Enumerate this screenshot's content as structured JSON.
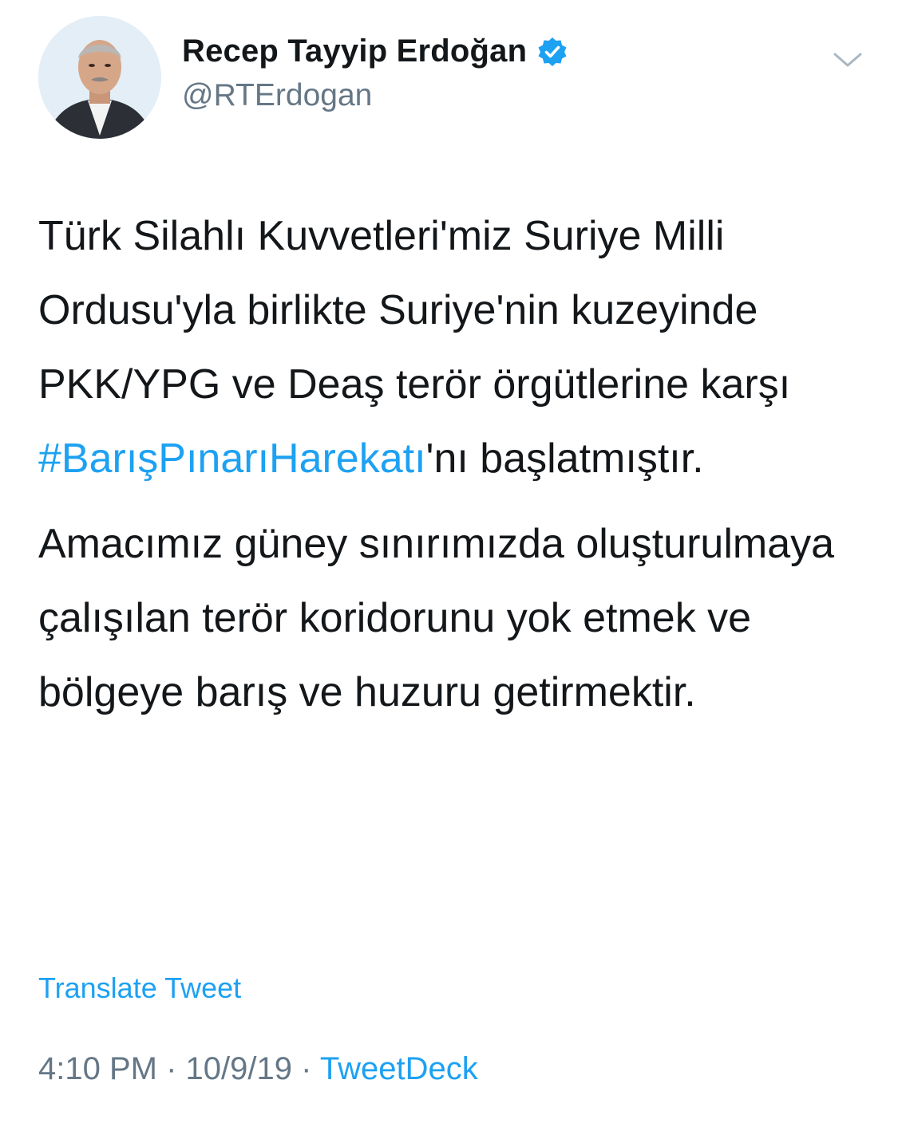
{
  "author": {
    "display_name": "Recep Tayyip Erdoğan",
    "handle": "@RTErdogan",
    "verified": true
  },
  "tweet": {
    "paragraph1": {
      "text_before": "Türk Silahlı Kuvvetleri'miz Suriye Milli Ordusu'yla birlikte Suriye'nin kuzeyinde PKK/YPG ve Deaş terör örgütlerine karşı ",
      "hashtag": "#BarışPınarıHarekatı",
      "text_after": "'nı başlatmıştır."
    },
    "paragraph2": "Amacımız güney sınırımızda oluşturulmaya çalışılan terör koridorunu yok etmek ve bölgeye barış ve huzuru getirmektir."
  },
  "translate_label": "Translate Tweet",
  "meta": {
    "time": "4:10 PM",
    "separator": "·",
    "date": "10/9/19",
    "source": "TweetDeck"
  },
  "colors": {
    "link": "#1da1f2",
    "secondary_text": "#657786",
    "primary_text": "#14171a",
    "avatar_background": "#e3eef6"
  },
  "icons": {
    "verified": "verified-badge-icon",
    "menu": "chevron-down-icon"
  }
}
